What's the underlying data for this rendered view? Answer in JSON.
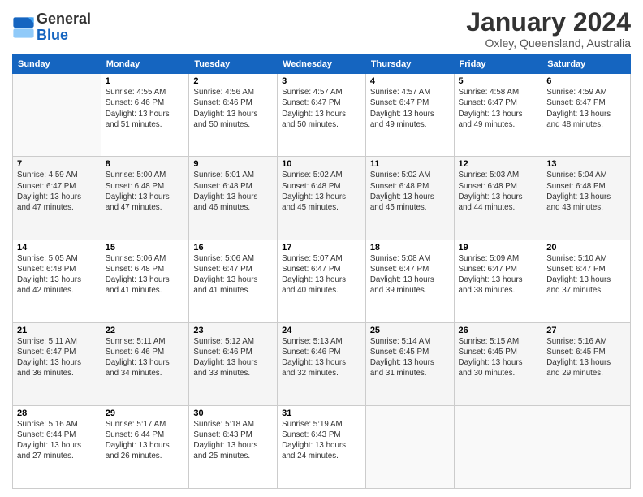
{
  "logo": {
    "line1": "General",
    "line2": "Blue"
  },
  "title": "January 2024",
  "location": "Oxley, Queensland, Australia",
  "days_of_week": [
    "Sunday",
    "Monday",
    "Tuesday",
    "Wednesday",
    "Thursday",
    "Friday",
    "Saturday"
  ],
  "weeks": [
    [
      {
        "day": "",
        "info": ""
      },
      {
        "day": "1",
        "info": "Sunrise: 4:55 AM\nSunset: 6:46 PM\nDaylight: 13 hours\nand 51 minutes."
      },
      {
        "day": "2",
        "info": "Sunrise: 4:56 AM\nSunset: 6:46 PM\nDaylight: 13 hours\nand 50 minutes."
      },
      {
        "day": "3",
        "info": "Sunrise: 4:57 AM\nSunset: 6:47 PM\nDaylight: 13 hours\nand 50 minutes."
      },
      {
        "day": "4",
        "info": "Sunrise: 4:57 AM\nSunset: 6:47 PM\nDaylight: 13 hours\nand 49 minutes."
      },
      {
        "day": "5",
        "info": "Sunrise: 4:58 AM\nSunset: 6:47 PM\nDaylight: 13 hours\nand 49 minutes."
      },
      {
        "day": "6",
        "info": "Sunrise: 4:59 AM\nSunset: 6:47 PM\nDaylight: 13 hours\nand 48 minutes."
      }
    ],
    [
      {
        "day": "7",
        "info": "Sunrise: 4:59 AM\nSunset: 6:47 PM\nDaylight: 13 hours\nand 47 minutes."
      },
      {
        "day": "8",
        "info": "Sunrise: 5:00 AM\nSunset: 6:48 PM\nDaylight: 13 hours\nand 47 minutes."
      },
      {
        "day": "9",
        "info": "Sunrise: 5:01 AM\nSunset: 6:48 PM\nDaylight: 13 hours\nand 46 minutes."
      },
      {
        "day": "10",
        "info": "Sunrise: 5:02 AM\nSunset: 6:48 PM\nDaylight: 13 hours\nand 45 minutes."
      },
      {
        "day": "11",
        "info": "Sunrise: 5:02 AM\nSunset: 6:48 PM\nDaylight: 13 hours\nand 45 minutes."
      },
      {
        "day": "12",
        "info": "Sunrise: 5:03 AM\nSunset: 6:48 PM\nDaylight: 13 hours\nand 44 minutes."
      },
      {
        "day": "13",
        "info": "Sunrise: 5:04 AM\nSunset: 6:48 PM\nDaylight: 13 hours\nand 43 minutes."
      }
    ],
    [
      {
        "day": "14",
        "info": "Sunrise: 5:05 AM\nSunset: 6:48 PM\nDaylight: 13 hours\nand 42 minutes."
      },
      {
        "day": "15",
        "info": "Sunrise: 5:06 AM\nSunset: 6:48 PM\nDaylight: 13 hours\nand 41 minutes."
      },
      {
        "day": "16",
        "info": "Sunrise: 5:06 AM\nSunset: 6:47 PM\nDaylight: 13 hours\nand 41 minutes."
      },
      {
        "day": "17",
        "info": "Sunrise: 5:07 AM\nSunset: 6:47 PM\nDaylight: 13 hours\nand 40 minutes."
      },
      {
        "day": "18",
        "info": "Sunrise: 5:08 AM\nSunset: 6:47 PM\nDaylight: 13 hours\nand 39 minutes."
      },
      {
        "day": "19",
        "info": "Sunrise: 5:09 AM\nSunset: 6:47 PM\nDaylight: 13 hours\nand 38 minutes."
      },
      {
        "day": "20",
        "info": "Sunrise: 5:10 AM\nSunset: 6:47 PM\nDaylight: 13 hours\nand 37 minutes."
      }
    ],
    [
      {
        "day": "21",
        "info": "Sunrise: 5:11 AM\nSunset: 6:47 PM\nDaylight: 13 hours\nand 36 minutes."
      },
      {
        "day": "22",
        "info": "Sunrise: 5:11 AM\nSunset: 6:46 PM\nDaylight: 13 hours\nand 34 minutes."
      },
      {
        "day": "23",
        "info": "Sunrise: 5:12 AM\nSunset: 6:46 PM\nDaylight: 13 hours\nand 33 minutes."
      },
      {
        "day": "24",
        "info": "Sunrise: 5:13 AM\nSunset: 6:46 PM\nDaylight: 13 hours\nand 32 minutes."
      },
      {
        "day": "25",
        "info": "Sunrise: 5:14 AM\nSunset: 6:45 PM\nDaylight: 13 hours\nand 31 minutes."
      },
      {
        "day": "26",
        "info": "Sunrise: 5:15 AM\nSunset: 6:45 PM\nDaylight: 13 hours\nand 30 minutes."
      },
      {
        "day": "27",
        "info": "Sunrise: 5:16 AM\nSunset: 6:45 PM\nDaylight: 13 hours\nand 29 minutes."
      }
    ],
    [
      {
        "day": "28",
        "info": "Sunrise: 5:16 AM\nSunset: 6:44 PM\nDaylight: 13 hours\nand 27 minutes."
      },
      {
        "day": "29",
        "info": "Sunrise: 5:17 AM\nSunset: 6:44 PM\nDaylight: 13 hours\nand 26 minutes."
      },
      {
        "day": "30",
        "info": "Sunrise: 5:18 AM\nSunset: 6:43 PM\nDaylight: 13 hours\nand 25 minutes."
      },
      {
        "day": "31",
        "info": "Sunrise: 5:19 AM\nSunset: 6:43 PM\nDaylight: 13 hours\nand 24 minutes."
      },
      {
        "day": "",
        "info": ""
      },
      {
        "day": "",
        "info": ""
      },
      {
        "day": "",
        "info": ""
      }
    ]
  ]
}
